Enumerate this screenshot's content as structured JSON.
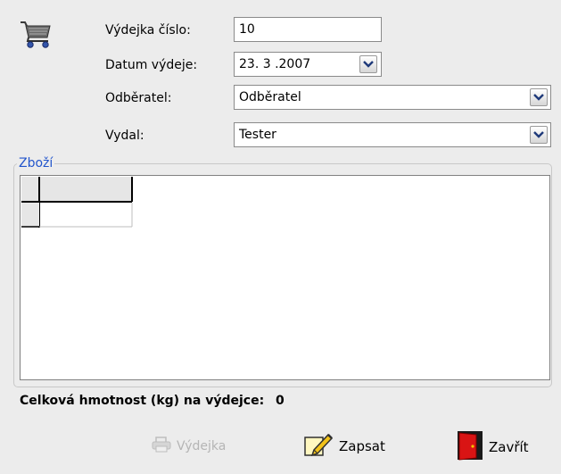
{
  "form": {
    "number_label": "Výdejka číslo:",
    "number_value": "10",
    "date_label": "Datum výdeje:",
    "date_value": "23. 3 .2007",
    "customer_label": "Odběratel:",
    "customer_value": "Odběratel",
    "issuer_label": "Vydal:",
    "issuer_value": "Tester"
  },
  "goods": {
    "legend": "Zboží"
  },
  "summary": {
    "weight_label": "Celková hmotnost (kg) na výdejce:",
    "weight_value": "0"
  },
  "buttons": {
    "print_label": "Výdejka",
    "save_label": "Zapsat",
    "close_label": "Zavřít"
  },
  "icons": {
    "header": "cart-icon",
    "print": "printer-icon",
    "save": "pencil-icon",
    "close": "door-icon"
  },
  "colors": {
    "background": "#ececec",
    "legend": "#2255cc",
    "disabled_text": "#b5b5b5"
  }
}
